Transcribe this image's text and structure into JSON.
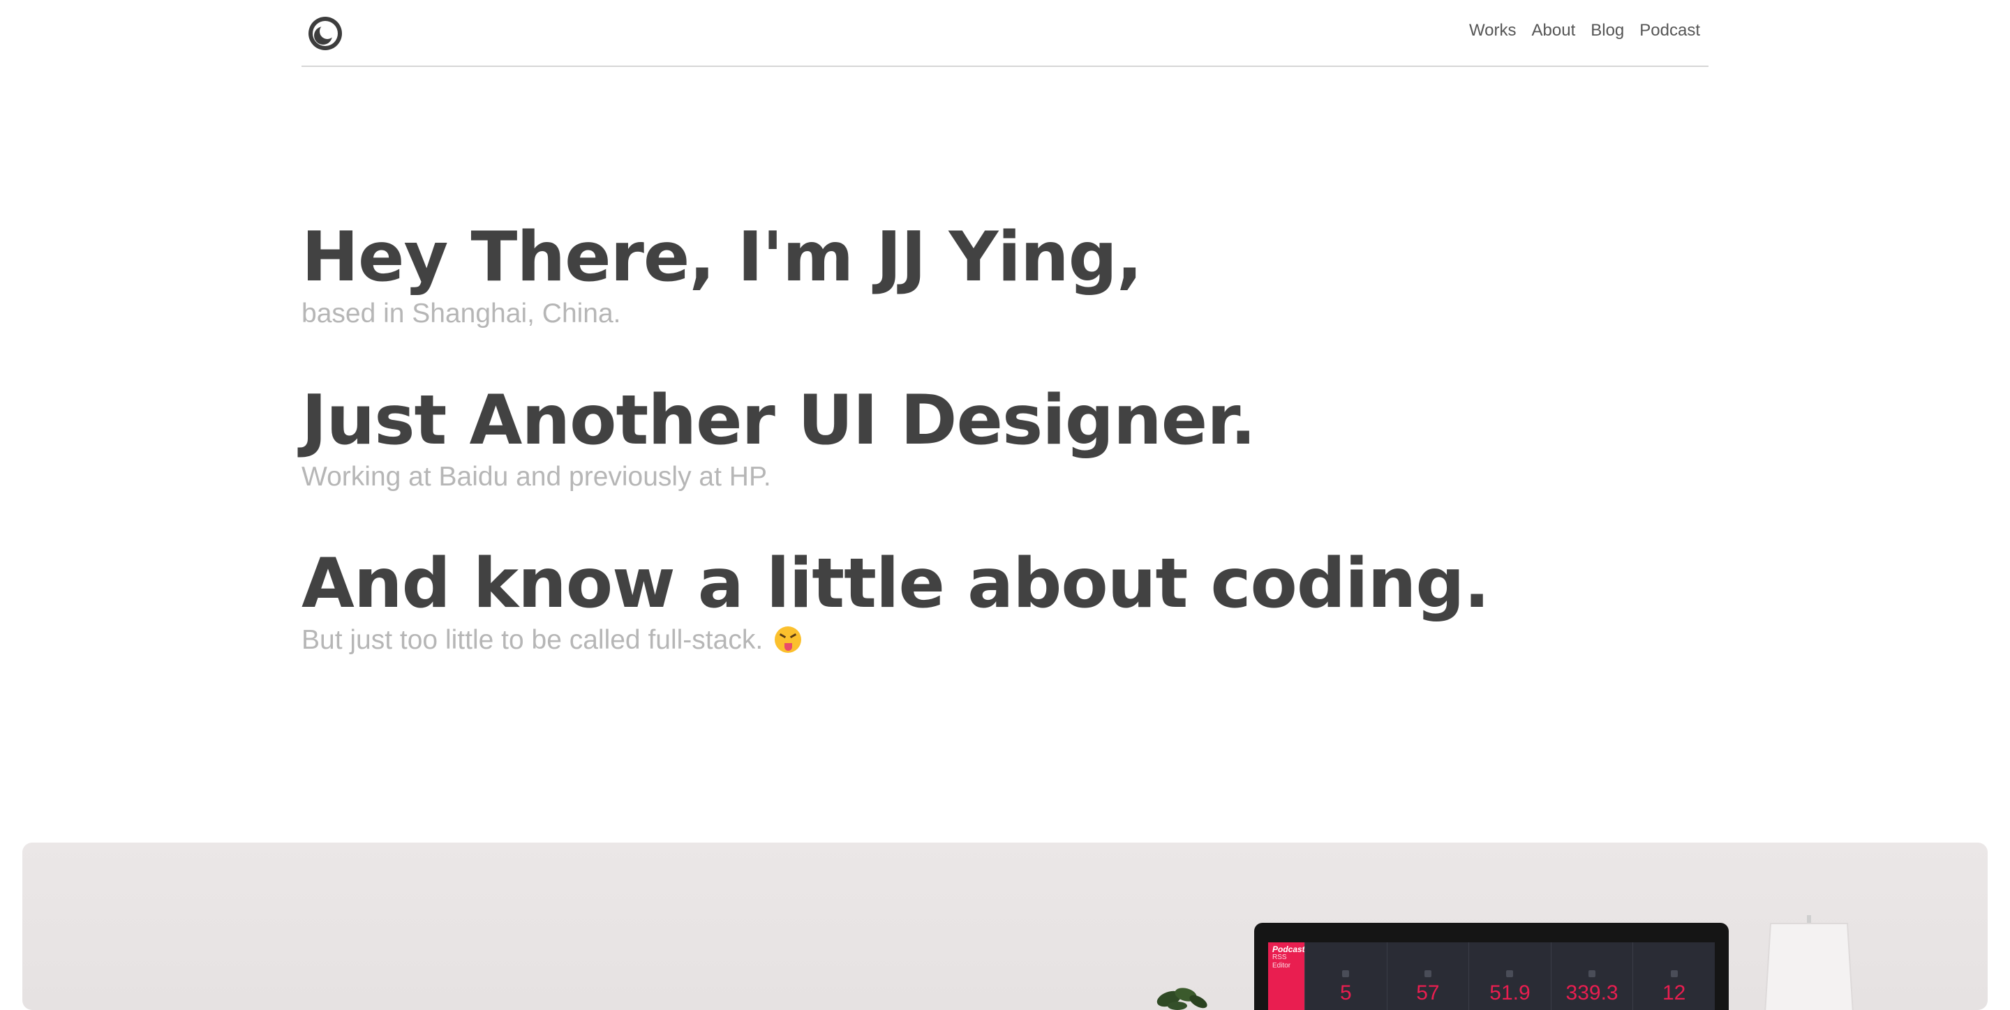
{
  "nav": {
    "items": [
      "Works",
      "About",
      "Blog",
      "Podcast"
    ]
  },
  "intro": {
    "lines": [
      {
        "headline": "Hey There, I'm JJ Ying,",
        "sub": "based in Shanghai, China."
      },
      {
        "headline": "Just Another UI Designer.",
        "sub": "Working at Baidu and previously at HP."
      },
      {
        "headline": "And know a little about coding.",
        "sub": "But just too little to be called full-stack."
      }
    ]
  },
  "hero": {
    "app_sidebar": {
      "title": "Podcast",
      "line2": "RSS",
      "line3": "Editor"
    },
    "stats": [
      "5",
      "57",
      "51.9",
      "339.3",
      "12"
    ]
  },
  "colors": {
    "text_dark": "#424242",
    "text_muted": "#b6b6b6",
    "accent": "#e91e50",
    "hero_bg": "#ebe7e7"
  },
  "icons": {
    "logo": "crescent-circle-logo",
    "emoji": "squinting-face-with-tongue"
  }
}
